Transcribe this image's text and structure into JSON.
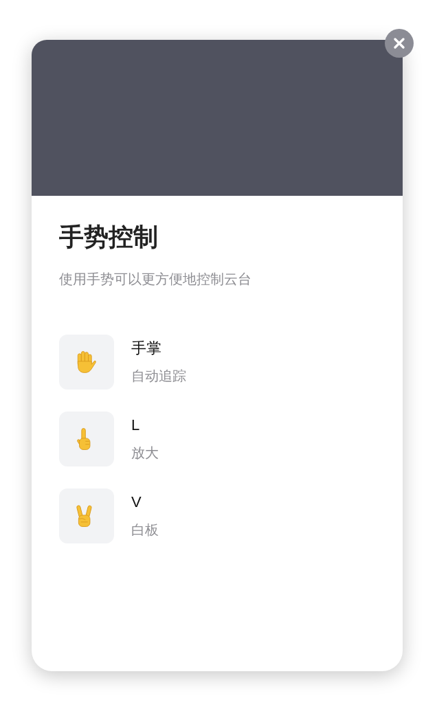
{
  "title": "手势控制",
  "subtitle": "使用手势可以更方便地控制云台",
  "gestures": [
    {
      "kind": "palm",
      "name": "手掌",
      "action": "自动追踪"
    },
    {
      "kind": "pointer",
      "name": "L",
      "action": "放大"
    },
    {
      "kind": "victory",
      "name": "V",
      "action": "白板"
    }
  ]
}
